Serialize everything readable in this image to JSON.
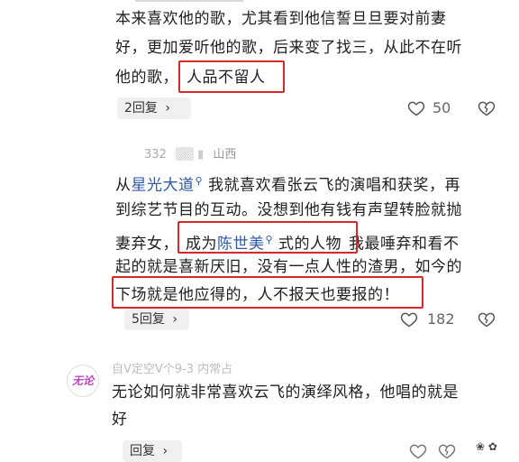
{
  "comment1": {
    "lines": [
      "本来喜欢他的歌，尤其看到他信誓旦旦要对前妻",
      "好，更加爱听他的歌，后来变了找三，从此不在听",
      "他的歌，"
    ],
    "highlight": "人品不留人",
    "reply_label": "2回复",
    "likes": "50"
  },
  "comment2": {
    "meta_user": "332",
    "meta_location": "山西",
    "line1_prefix": "从",
    "line1_link": "星光大道",
    "line1_suffix": "我就喜欢看张云飞的演唱和获奖，再",
    "line2": "到综艺节目的互动。没想到他有钱有声望转脸就抛",
    "line3_prefix": "妻弃女，",
    "line3_hl_a": "成为",
    "line3_hl_link": "陈世美",
    "line3_hl_b": "式的人物",
    "line3_suffix": "我最唾弃和看不",
    "line4": "起的就是喜新厌旧，没有一点人性的渣男，如今的",
    "line5_hl": "下场就是他应得的，人不报天也要报的！",
    "reply_label": "5回复",
    "likes": "182"
  },
  "comment3": {
    "avatar_text": "无论",
    "meta": "自V定空V个9-3 内常占",
    "lines": [
      "无论如何就非常喜欢云飞的演绎风格，他唱的就是",
      "好"
    ],
    "reply_label": "回复"
  },
  "icons": {
    "heart": "heart-outline-icon",
    "dislike": "broken-heart-icon",
    "chevron": "chevron-right-icon",
    "search": "search-mark-icon"
  },
  "colors": {
    "highlight_border": "#d62a2a",
    "link": "#2e5aa8"
  }
}
